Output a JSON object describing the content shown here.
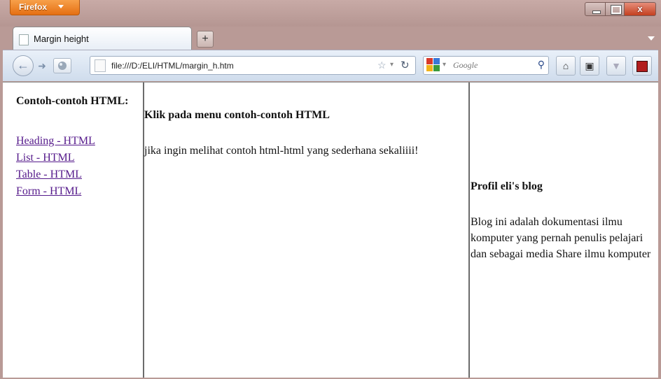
{
  "browser": {
    "app_button_label": "Firefox",
    "tab_title": "Margin height",
    "new_tab_label": "+",
    "url": "file:///D:/ELI/HTML/margin_h.htm",
    "search_placeholder": "Google",
    "close_label": "x"
  },
  "left_frame": {
    "heading": "Contoh-contoh HTML:",
    "links": [
      {
        "label": "Heading - HTML"
      },
      {
        "label": "List - HTML"
      },
      {
        "label": "Table - HTML"
      },
      {
        "label": "Form - HTML"
      }
    ]
  },
  "main_frame": {
    "heading": "Klik pada menu contoh-contoh HTML",
    "text": "jika ingin melihat contoh html-html yang sederhana sekaliiii!"
  },
  "right_frame": {
    "heading": "Profil eli's blog",
    "text": "Blog ini adalah dokumentasi ilmu komputer yang pernah penulis pelajari dan sebagai media Share ilmu komputer"
  },
  "colors": {
    "link": "#551a8b",
    "firefox_button": "#e56f12",
    "chrome": "#b99a96"
  }
}
